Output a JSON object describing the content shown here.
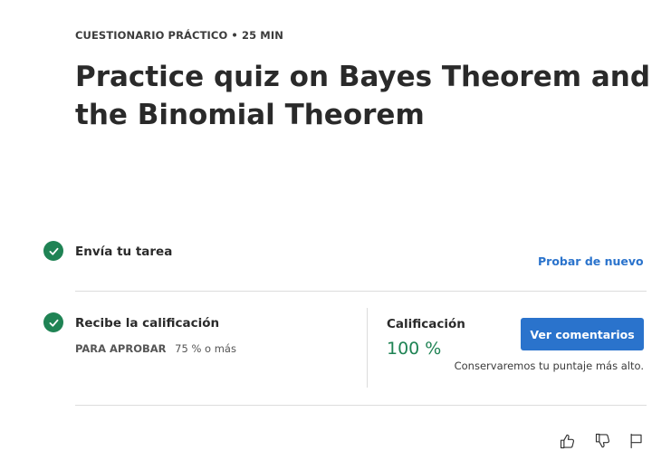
{
  "header": {
    "kicker": "CUESTIONARIO PRÁCTICO • 25 MIN",
    "title": "Practice quiz on Bayes Theorem and the Binomial Theorem"
  },
  "steps": {
    "submit": {
      "label": "Envía tu tarea",
      "action": "Probar de nuevo",
      "status_icon": "check-icon"
    },
    "grade": {
      "label": "Recibe la calificación",
      "status_icon": "check-icon",
      "pass_label": "PARA APROBAR",
      "pass_value": "75 % o más",
      "grade_label": "Calificación",
      "grade_value": "100 %",
      "button_label": "Ver comentarios",
      "note": "Conservaremos tu puntaje más alto."
    }
  },
  "feedback": {
    "icons": [
      "thumbs-up-icon",
      "thumbs-down-icon",
      "flag-icon"
    ]
  },
  "colors": {
    "accent": "#2a73cc",
    "success": "#1f8354"
  }
}
